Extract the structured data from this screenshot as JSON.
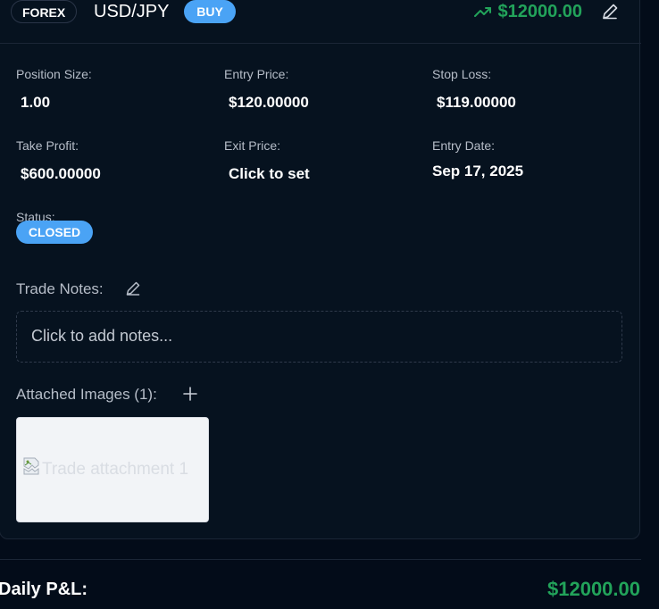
{
  "trade": {
    "market": "FOREX",
    "pair": "USD/JPY",
    "direction": "BUY",
    "pnl": "$12000.00",
    "icons": {
      "trend": "trending-up-icon",
      "edit": "pencil-icon"
    }
  },
  "fields": {
    "position_size": {
      "label": "Position Size:",
      "value": "1.00"
    },
    "entry_price": {
      "label": "Entry Price:",
      "value": "$120.00000"
    },
    "stop_loss": {
      "label": "Stop Loss:",
      "value": "$119.00000"
    },
    "take_profit": {
      "label": "Take Profit:",
      "value": "$600.00000"
    },
    "exit_price": {
      "label": "Exit Price:",
      "value": "Click to set"
    },
    "entry_date": {
      "label": "Entry Date:",
      "value": "Sep 17, 2025"
    },
    "status": {
      "label": "Status:",
      "value": "CLOSED"
    }
  },
  "notes": {
    "title": "Trade Notes:",
    "placeholder": "Click to add notes..."
  },
  "images": {
    "title": "Attached Images (1):",
    "items": [
      {
        "alt": "Trade attachment 1"
      }
    ]
  },
  "daily": {
    "label": "Daily P&L:",
    "value": "$12000.00"
  },
  "colors": {
    "background": "#030c19",
    "card": "#06121f",
    "accent_blue": "#4aa3f5",
    "profit_green": "#22a35a"
  }
}
